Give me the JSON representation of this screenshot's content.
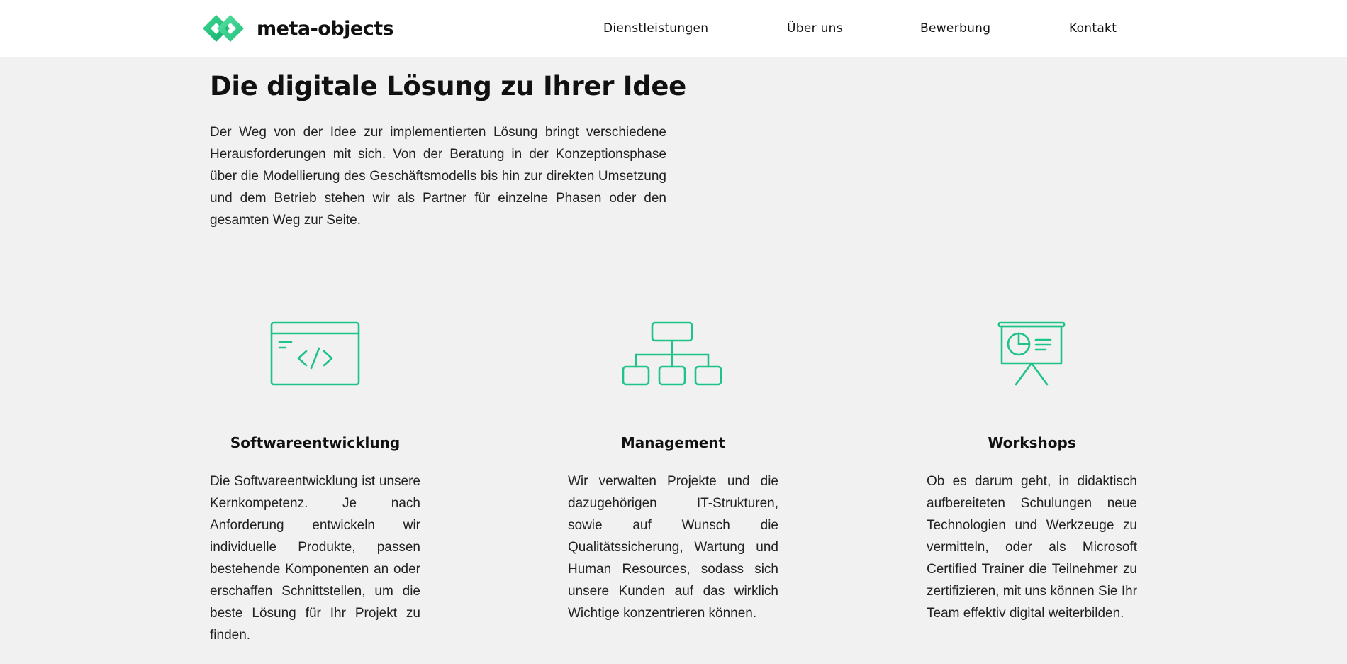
{
  "header": {
    "brand": "meta-objects",
    "nav": [
      "Dienstleistungen",
      "Über uns",
      "Bewerbung",
      "Kontakt"
    ]
  },
  "hero": {
    "title": "Die digitale Lösung zu Ihrer Idee",
    "text": "Der Weg von der Idee zur implementierten Lösung bringt verschiedene Herausforderungen mit sich. Von der Beratung in der Konzeptionsphase über die Modellierung des Geschäftsmodells bis hin zur direkten Umsetzung und dem Betrieb stehen wir als Partner für einzelne Phasen oder den gesamten Weg zur Seite."
  },
  "services": [
    {
      "icon": "code-window-icon",
      "title": "Softwareentwicklung",
      "text": "Die Softwareentwicklung ist unsere Kernkompetenz. Je nach Anforderung entwickeln wir individuelle Produkte, passen bestehende Komponenten an oder erschaffen Schnittstellen, um die beste Lösung für Ihr Projekt zu finden."
    },
    {
      "icon": "org-chart-icon",
      "title": "Management",
      "text": "Wir verwalten Projekte und die dazugehörigen IT-Strukturen, sowie auf Wunsch die Qualitätssicherung, Wartung und Human Resources, sodass sich unsere Kunden auf das wirklich Wichtige konzentrieren können."
    },
    {
      "icon": "presentation-board-icon",
      "title": "Workshops",
      "text": "Ob es darum geht, in didaktisch aufbereiteten Schulungen neue Technologien und Werkzeuge zu vermitteln, oder als Microsoft Certified Trainer die Teilnehmer zu zertifizieren, mit uns können Sie Ihr Team effektiv digital weiterbilden."
    }
  ],
  "colors": {
    "accent": "#20c387",
    "accent_dark": "#18a06c",
    "background": "#f1f1f1",
    "header_bg": "#ffffff",
    "text": "#111111"
  }
}
